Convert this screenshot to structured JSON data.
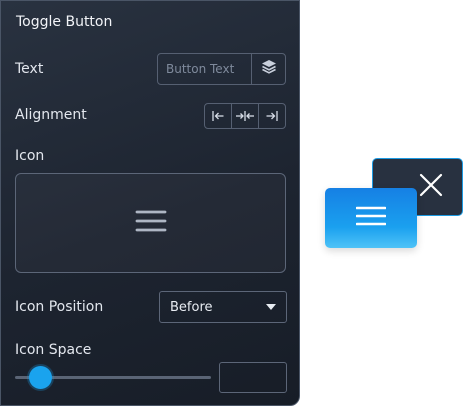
{
  "panel": {
    "title": "Toggle Button",
    "text_label": "Text",
    "text_placeholder": "Button Text",
    "text_value": "",
    "alignment_label": "Alignment",
    "alignment_options": [
      "align-left-icon",
      "align-center-icon",
      "align-right-icon"
    ],
    "icon_label": "Icon",
    "selected_icon": "hamburger-menu-icon",
    "icon_position_label": "Icon Position",
    "icon_position_value": "Before",
    "icon_space_label": "Icon Space",
    "icon_space_value": "",
    "icon_space_slider_fraction": 0.13
  },
  "preview": {
    "close_icon": "close-icon",
    "menu_icon": "hamburger-menu-icon"
  },
  "colors": {
    "accent": "#1aa3ee",
    "panel_bg": "#1f2733",
    "border": "#566072",
    "close_button_bg": "#283140",
    "menu_gradient_top": "#1680e4",
    "menu_gradient_bottom": "#4fc3f7"
  }
}
